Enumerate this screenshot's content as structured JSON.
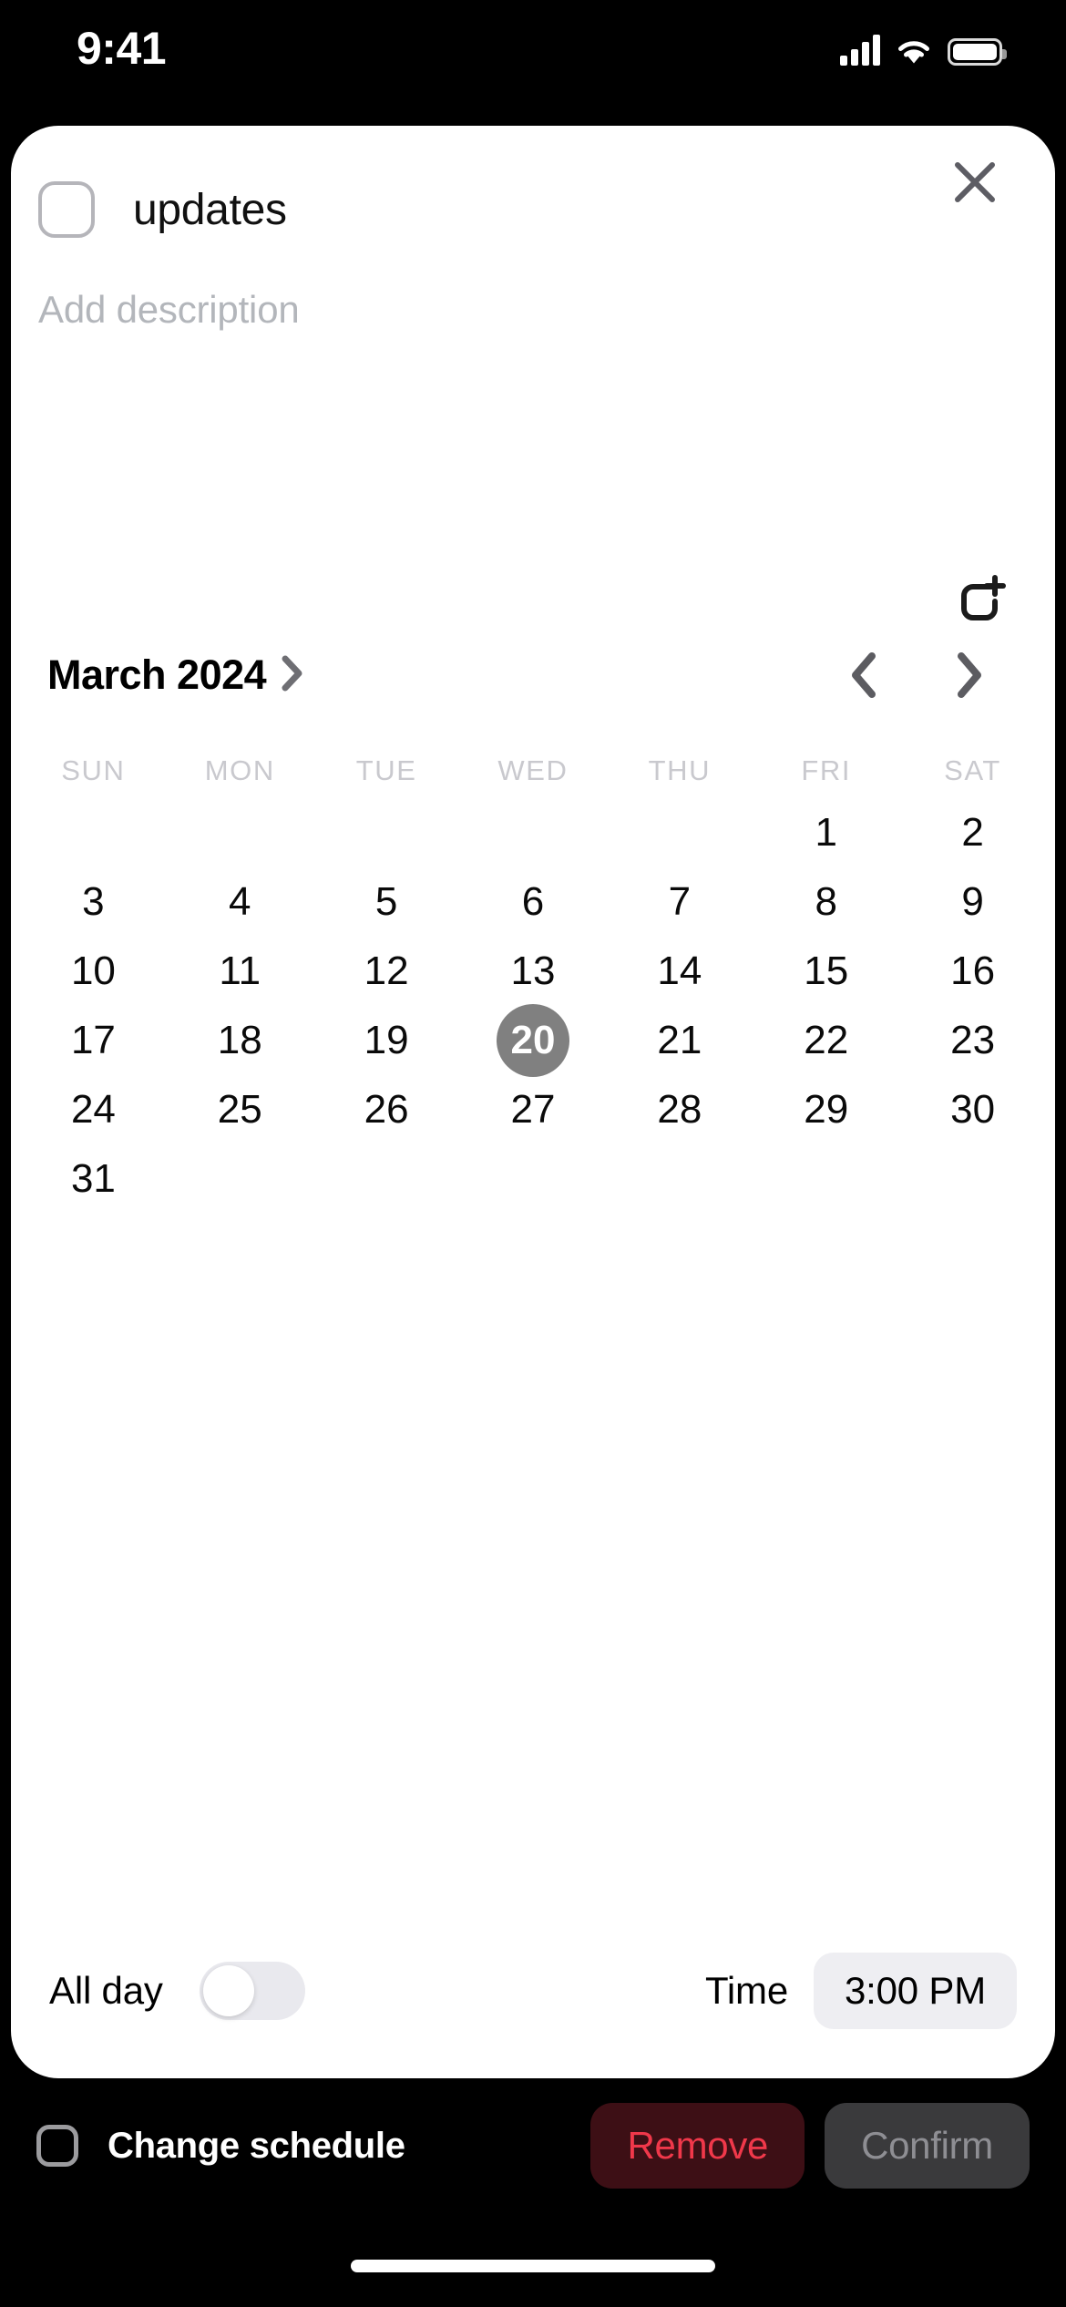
{
  "status_bar": {
    "time": "9:41",
    "icons": [
      "cellular-signal-icon",
      "wifi-icon",
      "battery-icon"
    ]
  },
  "task_sheet": {
    "checkbox": {
      "name": "task-complete-checkbox",
      "checked": false
    },
    "title": "updates",
    "description_placeholder": "Add description",
    "close_label": "×",
    "repeat_icon": "add-repeat-icon"
  },
  "calendar": {
    "month_label": "March 2024",
    "month_chevron": "chevron-right-icon",
    "prev_icon": "chevron-left-icon",
    "next_icon": "chevron-right-icon",
    "weekdays": [
      "SUN",
      "MON",
      "TUE",
      "WED",
      "THU",
      "FRI",
      "SAT"
    ],
    "leading_blanks": 5,
    "days": [
      1,
      2,
      3,
      4,
      5,
      6,
      7,
      8,
      9,
      10,
      11,
      12,
      13,
      14,
      15,
      16,
      17,
      18,
      19,
      20,
      21,
      22,
      23,
      24,
      25,
      26,
      27,
      28,
      29,
      30,
      31
    ],
    "selected_day": 20,
    "selected_bg": "#808080"
  },
  "schedule": {
    "all_day_label": "All day",
    "all_day_on": false,
    "time_label": "Time",
    "time_value": "3:00 PM"
  },
  "action_bar": {
    "change_schedule_label": "Change schedule",
    "change_schedule_checked": false,
    "remove_label": "Remove",
    "confirm_label": "Confirm",
    "remove_color": "#f0384a",
    "confirm_color": "#8e8e93"
  }
}
